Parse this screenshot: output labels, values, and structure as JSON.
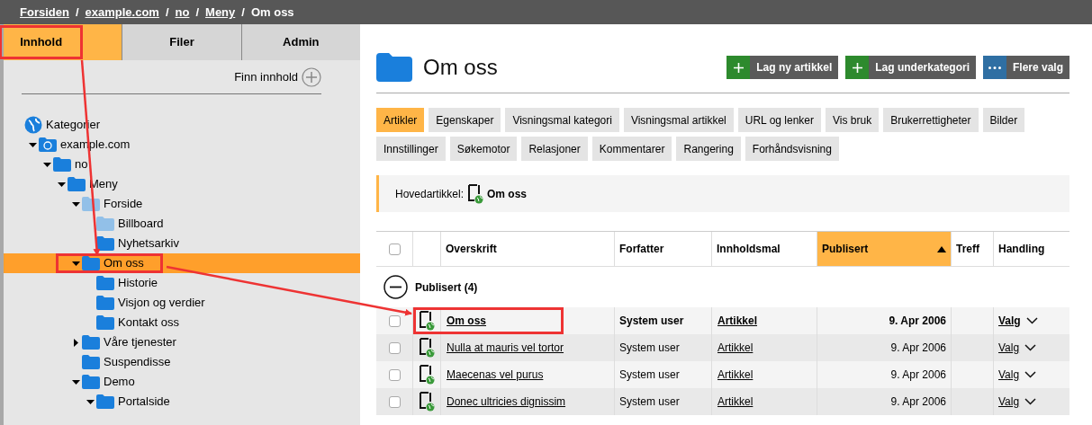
{
  "breadcrumb": {
    "separator": "/",
    "items": [
      {
        "label": "Forsiden",
        "link": true
      },
      {
        "label": "example.com",
        "link": true
      },
      {
        "label": "no",
        "link": true
      },
      {
        "label": "Meny",
        "link": true
      },
      {
        "label": "Om oss",
        "link": false
      }
    ]
  },
  "sidebar": {
    "tabs": [
      {
        "label": "Innhold",
        "selected": true
      },
      {
        "label": "Filer",
        "selected": false
      },
      {
        "label": "Admin",
        "selected": false
      }
    ],
    "find": "Finn innhold",
    "tree": [
      {
        "label": "Kategorier",
        "kind": "globe",
        "selected": false,
        "faded": false,
        "children": [
          {
            "label": "example.com",
            "kind": "site",
            "expanded": true,
            "selected": false,
            "faded": false,
            "children": [
              {
                "label": "no",
                "kind": "folder",
                "expanded": true,
                "selected": false,
                "faded": false,
                "children": [
                  {
                    "label": "Meny",
                    "kind": "folder",
                    "expanded": true,
                    "selected": false,
                    "faded": false,
                    "children": [
                      {
                        "label": "Forside",
                        "kind": "folder",
                        "expanded": true,
                        "selected": false,
                        "faded": true,
                        "children": [
                          {
                            "label": "Billboard",
                            "kind": "folder",
                            "selected": false,
                            "faded": true
                          },
                          {
                            "label": "Nyhetsarkiv",
                            "kind": "folder",
                            "selected": false,
                            "faded": false
                          }
                        ]
                      },
                      {
                        "label": "Om oss",
                        "kind": "folder",
                        "expanded": true,
                        "selected": true,
                        "faded": false,
                        "children": [
                          {
                            "label": "Historie",
                            "kind": "folder",
                            "selected": false,
                            "faded": false
                          },
                          {
                            "label": "Visjon og verdier",
                            "kind": "folder",
                            "selected": false,
                            "faded": false
                          },
                          {
                            "label": "Kontakt oss",
                            "kind": "folder",
                            "selected": false,
                            "faded": false
                          }
                        ]
                      },
                      {
                        "label": "Våre tjenester",
                        "kind": "folder",
                        "expanded": false,
                        "selected": false,
                        "faded": false
                      },
                      {
                        "label": "Suspendisse",
                        "kind": "folder",
                        "selected": false,
                        "faded": false
                      },
                      {
                        "label": "Demo",
                        "kind": "folder",
                        "expanded": true,
                        "selected": false,
                        "faded": false,
                        "children": [
                          {
                            "label": "Portalside",
                            "kind": "folder",
                            "expanded": true,
                            "selected": false,
                            "faded": false
                          }
                        ]
                      }
                    ]
                  }
                ]
              }
            ]
          }
        ]
      }
    ]
  },
  "main": {
    "title": "Om oss",
    "actions": [
      {
        "label": "Lag ny artikkel",
        "kind": "add"
      },
      {
        "label": "Lag underkategori",
        "kind": "add"
      },
      {
        "label": "Flere valg",
        "kind": "more"
      }
    ],
    "tabs": [
      {
        "label": "Artikler",
        "selected": true
      },
      {
        "label": "Egenskaper",
        "selected": false
      },
      {
        "label": "Visningsmal kategori",
        "selected": false
      },
      {
        "label": "Visningsmal artikkel",
        "selected": false
      },
      {
        "label": "URL og lenker",
        "selected": false
      },
      {
        "label": "Vis bruk",
        "selected": false
      },
      {
        "label": "Brukerrettigheter",
        "selected": false
      },
      {
        "label": "Bilder",
        "selected": false
      },
      {
        "label": "Innstillinger",
        "selected": false
      },
      {
        "label": "Søkemotor",
        "selected": false
      },
      {
        "label": "Relasjoner",
        "selected": false
      },
      {
        "label": "Kommentarer",
        "selected": false
      },
      {
        "label": "Rangering",
        "selected": false
      },
      {
        "label": "Forhåndsvisning",
        "selected": false
      }
    ],
    "main_article": {
      "label": "Hovedartikkel:",
      "title": "Om oss"
    },
    "table": {
      "all_checked": false,
      "columns": [
        {
          "label": "Overskrift",
          "sorted": false
        },
        {
          "label": "Forfatter",
          "sorted": false
        },
        {
          "label": "Innholdsmal",
          "sorted": false
        },
        {
          "label": "Publisert",
          "sorted": true
        },
        {
          "label": "Treff",
          "sorted": false
        },
        {
          "label": "Handling",
          "sorted": false
        }
      ],
      "group": {
        "label": "Publisert (4)",
        "expanded": true
      },
      "rows": [
        {
          "title": "Om oss",
          "author": "System user",
          "template": "Artikkel",
          "published": "9. Apr 2006",
          "action": "Valg",
          "checked": false,
          "current": true
        },
        {
          "title": "Nulla at mauris vel tortor",
          "author": "System user",
          "template": "Artikkel",
          "published": "9. Apr 2006",
          "action": "Valg",
          "checked": false,
          "current": false
        },
        {
          "title": "Maecenas vel purus",
          "author": "System user",
          "template": "Artikkel",
          "published": "9. Apr 2006",
          "action": "Valg",
          "checked": false,
          "current": false
        },
        {
          "title": "Donec ultricies dignissim",
          "author": "System user",
          "template": "Artikkel",
          "published": "9. Apr 2006",
          "action": "Valg",
          "checked": false,
          "current": false
        }
      ]
    }
  }
}
